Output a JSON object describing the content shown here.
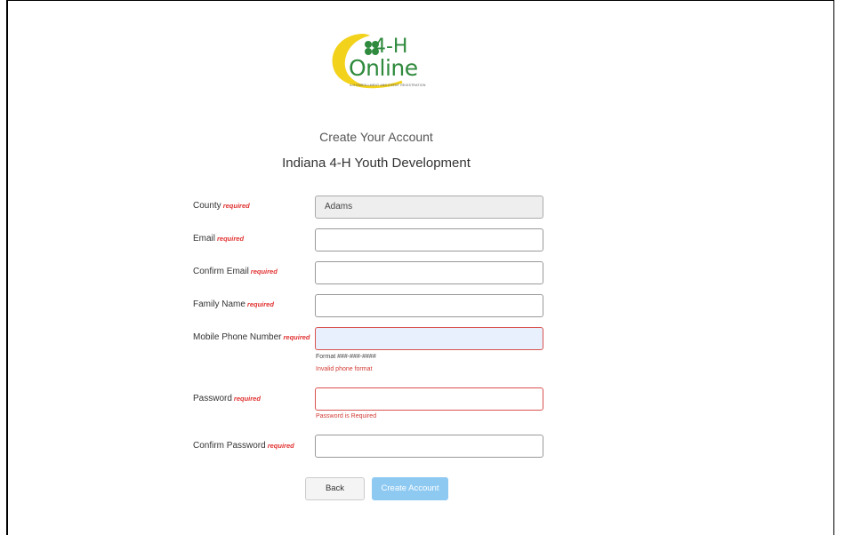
{
  "branding": {
    "logo_text_4h": "4-H",
    "logo_text_online": "Online",
    "logo_tagline": "4-H ENROLLMENT AND EVENT REGISTRATION",
    "colors": {
      "green": "#2f8a3d",
      "yellow": "#f2d21b"
    }
  },
  "page": {
    "title": "Create Your Account",
    "subtitle": "Indiana 4-H Youth Development"
  },
  "form": {
    "required_text": "required",
    "county": {
      "label": "County",
      "value": "Adams"
    },
    "email": {
      "label": "Email",
      "value": ""
    },
    "confirm_email": {
      "label": "Confirm Email",
      "value": ""
    },
    "family_name": {
      "label": "Family Name",
      "value": ""
    },
    "mobile_phone": {
      "label": "Mobile Phone Number",
      "value": "",
      "hint": "Format ###-###-####",
      "error": "Invalid phone format"
    },
    "password": {
      "label": "Password",
      "value": "",
      "error": "Password is Required"
    },
    "confirm_password": {
      "label": "Confirm Password",
      "value": ""
    }
  },
  "actions": {
    "back_label": "Back",
    "create_label": "Create Account",
    "create_color": "#8ec9f2"
  }
}
